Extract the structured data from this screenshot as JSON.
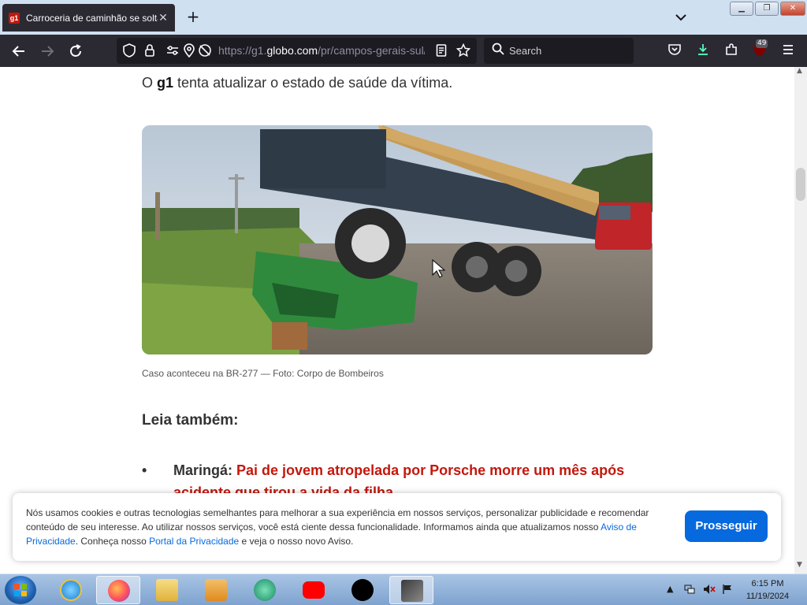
{
  "browser": {
    "tab": {
      "favicon_text": "g1",
      "title": "Carroceria de caminhão se solta",
      "close": "✕"
    },
    "new_tab": "+",
    "url_prefix": "https://g1.",
    "url_domain": "globo.com",
    "url_path": "/pr/campos-gerais-sul/",
    "search_placeholder": "Search",
    "extensions_badge": "49"
  },
  "article": {
    "paragraph_prefix": "O ",
    "paragraph_bold": "g1",
    "paragraph_rest": " tenta atualizar o estado de saúde da vítima.",
    "photo_caption": "Caso aconteceu na BR-277 — Foto: Corpo de Bombeiros",
    "related_title": "Leia também:",
    "related_items": [
      {
        "bullet": "•",
        "prefix": "Maringá: ",
        "link": "Pai de jovem atropelada por Porsche morre um mês após acidente que tirou a vida da filha"
      }
    ]
  },
  "cookie_banner": {
    "text_1": "Nós usamos cookies e outras tecnologias semelhantes para melhorar a sua experiência em nossos serviços, personalizar publicidade e recomendar conteúdo de seu interesse. Ao utilizar nossos serviços, você está ciente dessa funcionalidade. Informamos ainda que atualizamos nosso ",
    "link_1": "Aviso de Privacidade",
    "text_2": ". Conheça nosso ",
    "link_2": "Portal da Privacidade",
    "text_3": " e veja o nosso novo Aviso.",
    "button": "Prosseguir"
  },
  "taskbar": {
    "time": "6:15 PM",
    "date": "11/19/2024"
  },
  "colors": {
    "accent_red": "#c4170c",
    "button_blue": "#0669de",
    "toolbar_dark": "#2b2a33"
  }
}
